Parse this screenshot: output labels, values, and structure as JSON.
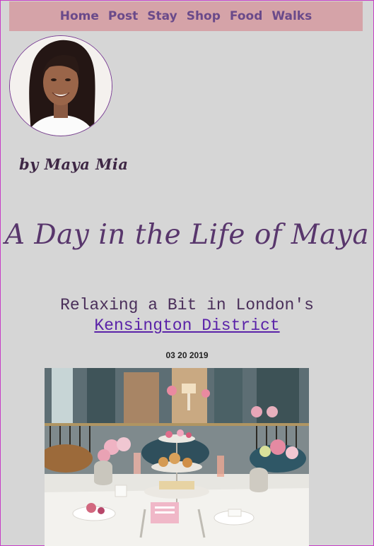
{
  "nav": {
    "items": [
      {
        "label": "Home"
      },
      {
        "label": "Post"
      },
      {
        "label": "Stay"
      },
      {
        "label": "Shop"
      },
      {
        "label": "Food"
      },
      {
        "label": "Walks"
      }
    ]
  },
  "author": {
    "byline": "by Maya Mia"
  },
  "post": {
    "title": "A Day in the Life of Maya",
    "subtitle_text": "Relaxing a Bit in London's",
    "subtitle_link": "Kensington District",
    "date": "03 20 2019"
  },
  "colors": {
    "background": "#d6d6d6",
    "nav_background": "#d5a3a8",
    "nav_text": "#6a4a8a",
    "title": "#58366c",
    "link": "#5a22a8",
    "frame_border": "#c63fc6"
  }
}
